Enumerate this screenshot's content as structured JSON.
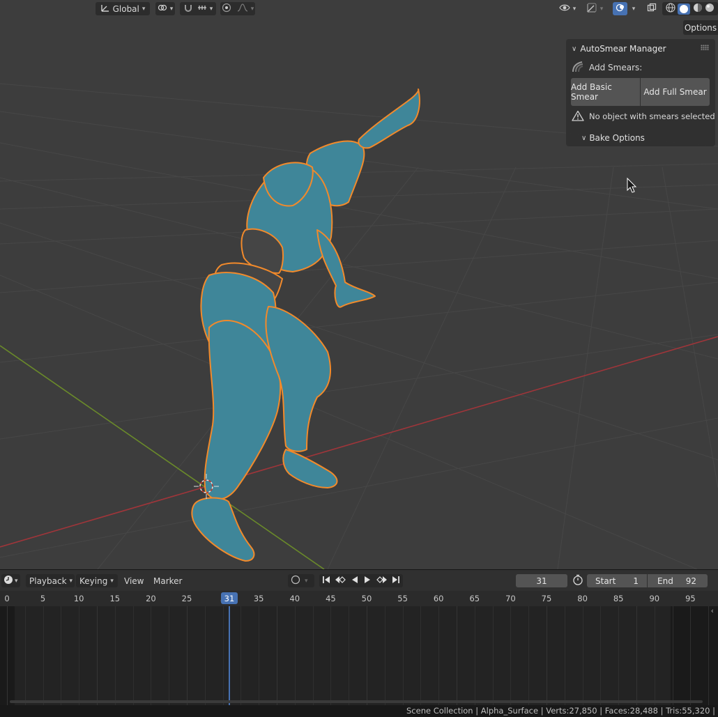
{
  "viewport_header": {
    "transform_orientation": "Global",
    "options_label": "Options"
  },
  "panel": {
    "title": "AutoSmear Manager",
    "add_smears_label": "Add Smears:",
    "add_basic_label": "Add Basic Smear",
    "add_full_label": "Add Full Smear",
    "warning_text": "No object with smears selected",
    "bake_options_label": "Bake Options"
  },
  "timeline": {
    "menus": {
      "playback": "Playback",
      "keying": "Keying",
      "view": "View",
      "marker": "Marker"
    },
    "current_frame": "31",
    "start_label": "Start",
    "start_value": "1",
    "end_label": "End",
    "end_value": "92",
    "ticks": [
      "0",
      "5",
      "10",
      "15",
      "20",
      "25",
      "3",
      "35",
      "40",
      "45",
      "50",
      "55",
      "60",
      "65",
      "70",
      "75",
      "80",
      "85",
      "90",
      "95"
    ],
    "playhead_label": "31"
  },
  "status": {
    "text": "Scene Collection | Alpha_Surface | Verts:27,850 | Faces:28,488 | Tris:55,320 |"
  },
  "colors": {
    "accent": "#4772b3",
    "mesh": "#3f8699",
    "selection_outline": "#f28a2b",
    "x_axis": "#a0353a",
    "y_axis": "#6a8a2a"
  }
}
